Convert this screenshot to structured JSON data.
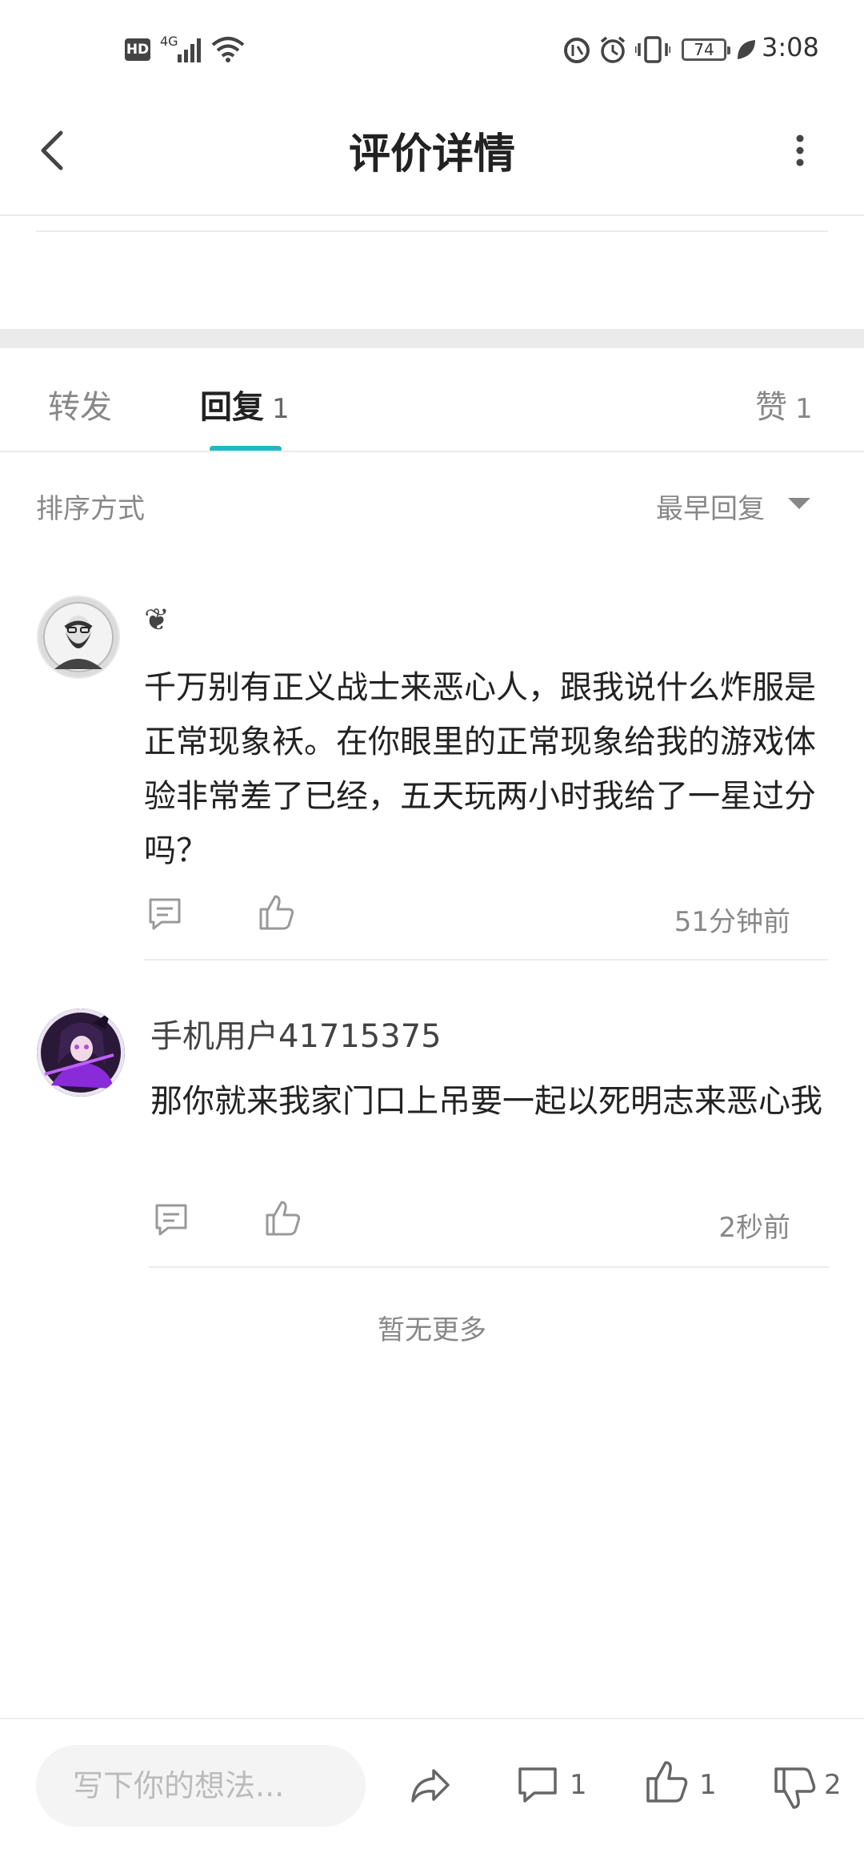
{
  "status_bar": {
    "hd_label": "HD",
    "network_label": "4G",
    "battery_level": "74",
    "time": "3:08"
  },
  "header": {
    "title": "评价详情"
  },
  "tabs": {
    "forward_label": "转发",
    "reply_label": "回复",
    "reply_count": "1",
    "like_label": "赞",
    "like_count": "1"
  },
  "sort": {
    "label": "排序方式",
    "value": "最早回复"
  },
  "comments": [
    {
      "username": "❦",
      "text": "千万别有正义战士来恶心人，跟我说什么炸服是正常现象袄。在你眼里的正常现象给我的游戏体验非常差了已经，五天玩两小时我给了一星过分吗？",
      "time": "51分钟前"
    },
    {
      "username": "手机用户41715375",
      "text": "那你就来我家门口上吊要一起以死明志来恶心我",
      "time": "2秒前"
    }
  ],
  "footer_note": "暂无更多",
  "bottom_bar": {
    "input_placeholder": "写下你的想法...",
    "comment_count": "1",
    "like_count": "1",
    "dislike_count": "2"
  },
  "colors": {
    "accent": "#1fb9c2",
    "divider": "#ebebeb",
    "muted_text": "#888888"
  }
}
